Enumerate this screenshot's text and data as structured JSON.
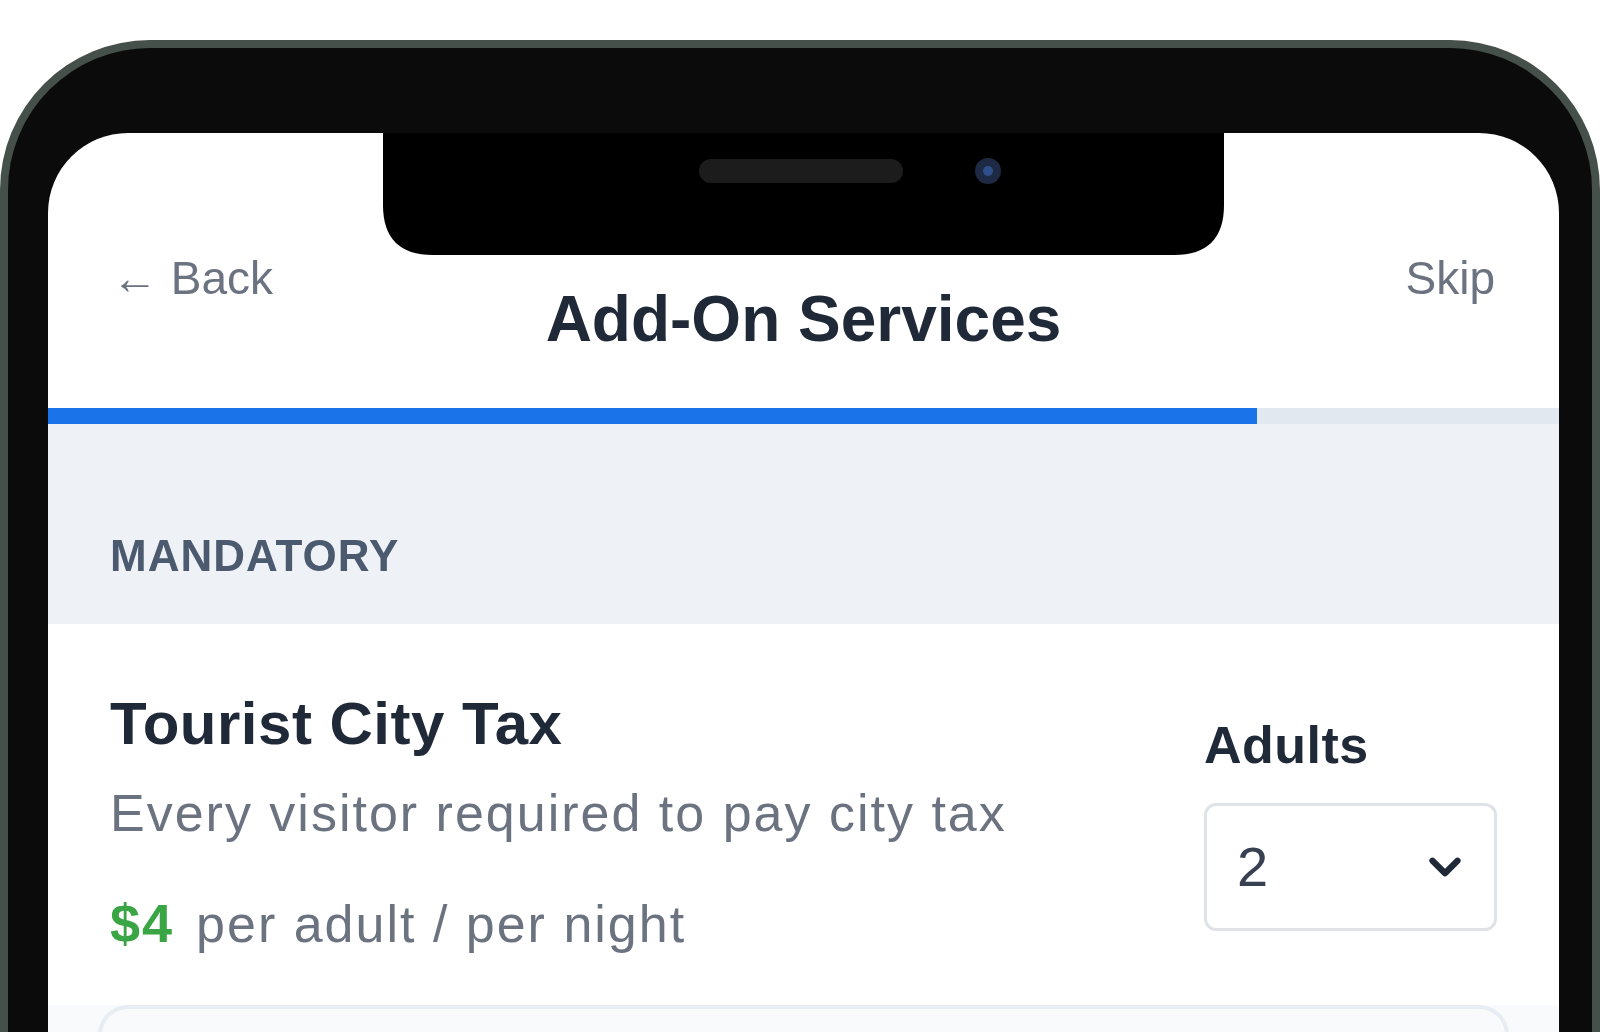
{
  "header": {
    "back": "← Back",
    "title": "Add-On Services",
    "skip": "Skip"
  },
  "progress": {
    "level": 0.8
  },
  "sections": [
    {
      "heading": "MANDATORY",
      "items": [
        {
          "name": "Tourist City Tax",
          "description": "Every visitor required to pay city tax",
          "price": "$4",
          "price_unit": "per adult / per night",
          "quantity": {
            "label": "Adults",
            "value": "2"
          }
        }
      ]
    }
  ]
}
